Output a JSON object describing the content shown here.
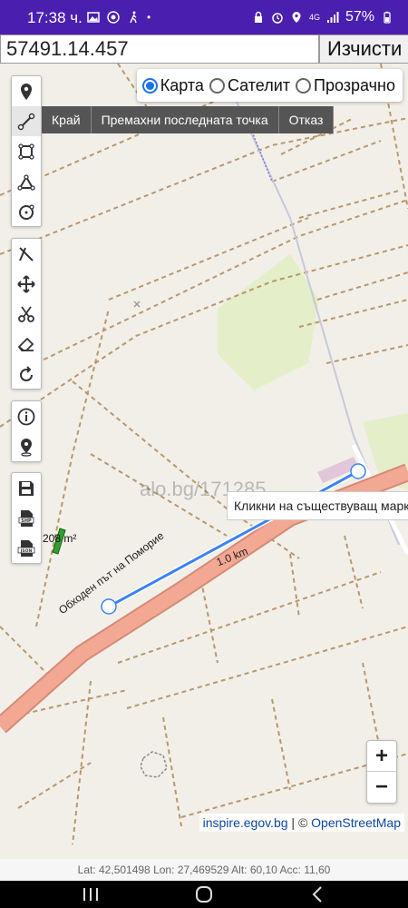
{
  "status_bar": {
    "time": "17:38 ч.",
    "battery": "57%",
    "network": "4G"
  },
  "top_bar": {
    "coordinate_value": "57491.14.457",
    "clear_label": "Изчисти"
  },
  "layers": {
    "options": [
      "Карта",
      "Сателит",
      "Прозрачно"
    ],
    "selected": "Карта"
  },
  "draw_menu": {
    "finish": "Край",
    "remove_last": "Премахни последната точка",
    "cancel": "Отказ"
  },
  "tools": [
    "marker-icon",
    "polyline-icon",
    "polygon-icon",
    "path-icon",
    "circle-icon",
    "cut-icon",
    "move-icon",
    "scissors-icon",
    "eraser-icon",
    "rotate-icon",
    "info-icon",
    "location-pin-icon",
    "save-icon",
    "shp-export-icon",
    "json-export-icon"
  ],
  "map": {
    "watermark": "alo.bg/171285",
    "tooltip": "Кликни на съществуващ маркер",
    "area_label": "208 m²",
    "distance_label": "1.0 km",
    "road_label": "Обходен път на Поморие",
    "colors": {
      "land": "#f2efe9",
      "road": "#f3a893",
      "parcel_border": "#b8976a",
      "measure_line": "#3b82f6",
      "green": "#e4eec8"
    }
  },
  "zoom": {
    "in": "+",
    "out": "−"
  },
  "attribution": {
    "source1": "inspire.egov.bg",
    "separator": " | © ",
    "source2": "OpenStreetMap"
  },
  "gps": "Lat: 42,501498 Lon: 27,469529 Alt: 60,10 Acc: 11,60"
}
